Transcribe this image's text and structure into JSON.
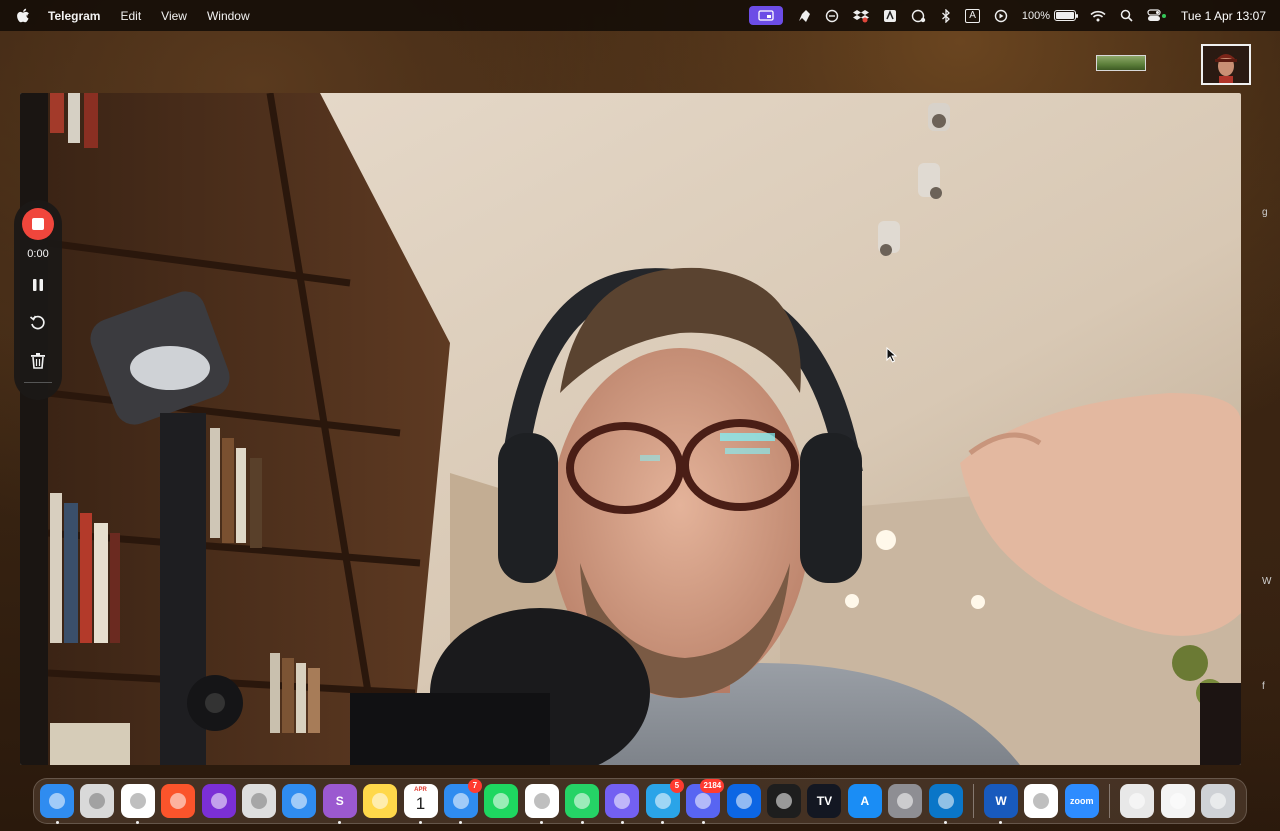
{
  "menubar": {
    "app_name": "Telegram",
    "menus": [
      "Edit",
      "View",
      "Window"
    ],
    "status": {
      "battery_percent": "100%",
      "battery_level": 1.0,
      "date_time": "Tue 1 Apr 13:07",
      "input_source": "A"
    }
  },
  "recorder": {
    "timer": "0:00",
    "stop_color": "#f0463c"
  },
  "dock": {
    "apps": [
      {
        "name": "Finder",
        "color": "#2f8cf0",
        "glyph": "",
        "dot": true
      },
      {
        "name": "Launchpad",
        "color": "#d9d9d9",
        "glyph": "",
        "dot": false
      },
      {
        "name": "Chrome",
        "color": "#ffffff",
        "glyph": "",
        "dot": true
      },
      {
        "name": "Brave",
        "color": "#fb542b",
        "glyph": "",
        "dot": false
      },
      {
        "name": "Firefox",
        "color": "#7b2fd6",
        "glyph": "",
        "dot": false
      },
      {
        "name": "Affinity",
        "color": "#dedede",
        "glyph": "",
        "dot": false
      },
      {
        "name": "Safari",
        "color": "#2f8cf0",
        "glyph": "",
        "dot": false
      },
      {
        "name": "Setapp",
        "color": "#9b59d0",
        "glyph": "S",
        "dot": true
      },
      {
        "name": "Notes",
        "color": "#ffd84a",
        "glyph": "",
        "dot": false
      },
      {
        "name": "Calendar",
        "color": "#ffffff",
        "glyph": "",
        "dot": true,
        "month": "APR",
        "day": "1"
      },
      {
        "name": "Mail",
        "color": "#2f8cf0",
        "glyph": "",
        "dot": true,
        "badge": "7"
      },
      {
        "name": "Spotify",
        "color": "#1ed760",
        "glyph": "",
        "dot": false
      },
      {
        "name": "Slack",
        "color": "#ffffff",
        "glyph": "",
        "dot": true
      },
      {
        "name": "WhatsApp",
        "color": "#25d366",
        "glyph": "",
        "dot": true
      },
      {
        "name": "Viber",
        "color": "#7360f2",
        "glyph": "",
        "dot": true
      },
      {
        "name": "Telegram",
        "color": "#2aa4e8",
        "glyph": "",
        "dot": true,
        "badge": "5"
      },
      {
        "name": "Discord",
        "color": "#5865f2",
        "glyph": "",
        "dot": true,
        "badge": "2184"
      },
      {
        "name": "Trello",
        "color": "#0c66e4",
        "glyph": "",
        "dot": false
      },
      {
        "name": "Figma",
        "color": "#1e1e1e",
        "glyph": "",
        "dot": false
      },
      {
        "name": "TradingView",
        "color": "#131722",
        "glyph": "TV",
        "dot": false
      },
      {
        "name": "App Store",
        "color": "#1a8df5",
        "glyph": "A",
        "dot": false
      },
      {
        "name": "System Settings",
        "color": "#8e8e93",
        "glyph": "",
        "dot": false
      },
      {
        "name": "VS Code",
        "color": "#0a76c8",
        "glyph": "",
        "dot": true
      }
    ],
    "apps_after_sep": [
      {
        "name": "Word",
        "color": "#185abd",
        "glyph": "W",
        "dot": true
      },
      {
        "name": "Perplexity",
        "color": "#ffffff",
        "glyph": "",
        "dot": false
      },
      {
        "name": "Zoom",
        "color": "#2d8cff",
        "glyph": "zoom",
        "dot": false
      }
    ],
    "stack_items": [
      {
        "name": "Document stack",
        "color": "#e8e8e8"
      },
      {
        "name": "Downloads stack",
        "color": "#f4f4f4"
      },
      {
        "name": "Trash",
        "color": "#cfd2d6"
      }
    ]
  },
  "peek_letters": [
    "g",
    "W",
    "f"
  ]
}
